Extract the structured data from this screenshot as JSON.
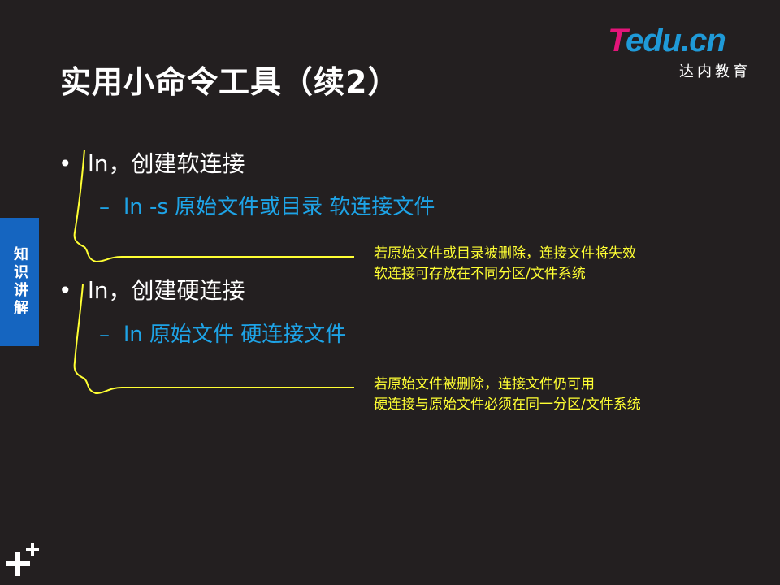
{
  "slide": {
    "title": "实用小命令工具（续2）"
  },
  "logo": {
    "letter": "T",
    "rest": "edu.cn",
    "subtitle": "达内教育"
  },
  "side_tab": {
    "label": "知识讲解"
  },
  "bullets": [
    {
      "marker": "•",
      "text": "ln，创建软连接",
      "sub_marker": "–",
      "sub_text": "ln  -s  原始文件或目录  软连接文件",
      "note_lines": [
        "若原始文件或目录被删除，连接文件将失效",
        "软连接可存放在不同分区/文件系统"
      ]
    },
    {
      "marker": "•",
      "text": "ln，创建硬连接",
      "sub_marker": "–",
      "sub_text": "ln  原始文件  硬连接文件",
      "note_lines": [
        "若原始文件被删除，连接文件仍可用",
        "硬连接与原始文件必须在同一分区/文件系统"
      ]
    }
  ],
  "colors": {
    "background": "#231f20",
    "title": "#ffffff",
    "sub_bullet": "#1ea3e6",
    "annotation": "#ffff33",
    "side_tab": "#1565c0",
    "logo_pink": "#e4157a",
    "logo_blue": "#1f9ad8"
  },
  "icons": {
    "corner_mark": "plus-plus-icon"
  }
}
